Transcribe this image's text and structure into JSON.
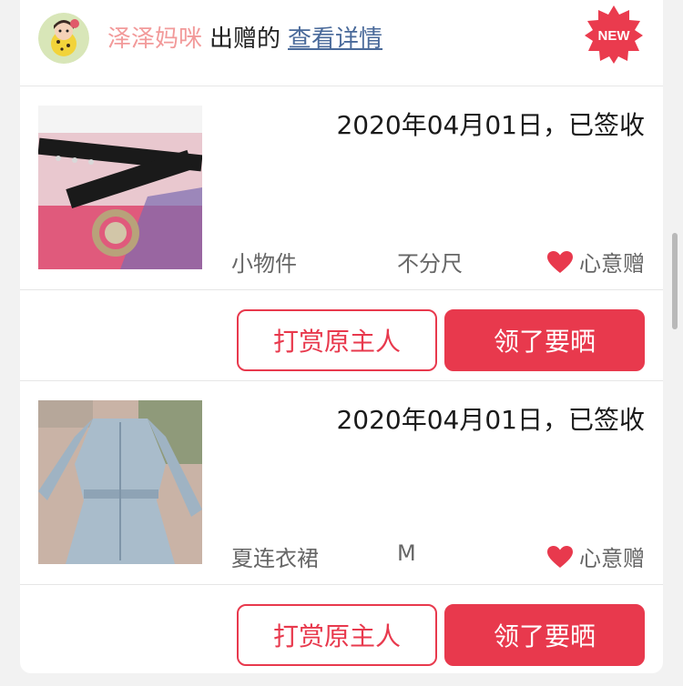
{
  "header": {
    "giver_name": "泽泽妈咪",
    "action_text": "出赠的",
    "detail_link": "查看详情",
    "badge": "NEW"
  },
  "items": [
    {
      "date_status": "2020年04月01日，已签收",
      "category": "小物件",
      "size": "不分尺",
      "gift_type": "心意赠",
      "photo_icon": "belt-photo",
      "buttons": {
        "reward_label": "打赏原主人",
        "claim_label": "领了要晒"
      }
    },
    {
      "date_status": "2020年04月01日，已签收",
      "category": "夏连衣裙",
      "size": "M",
      "gift_type": "心意赠",
      "photo_icon": "denim-dress-photo",
      "buttons": {
        "reward_label": "打赏原主人",
        "claim_label": "领了要晒"
      }
    }
  ],
  "colors": {
    "accent": "#e8394d",
    "giver_name": "#f29a9a",
    "link": "#4a6a9a"
  }
}
